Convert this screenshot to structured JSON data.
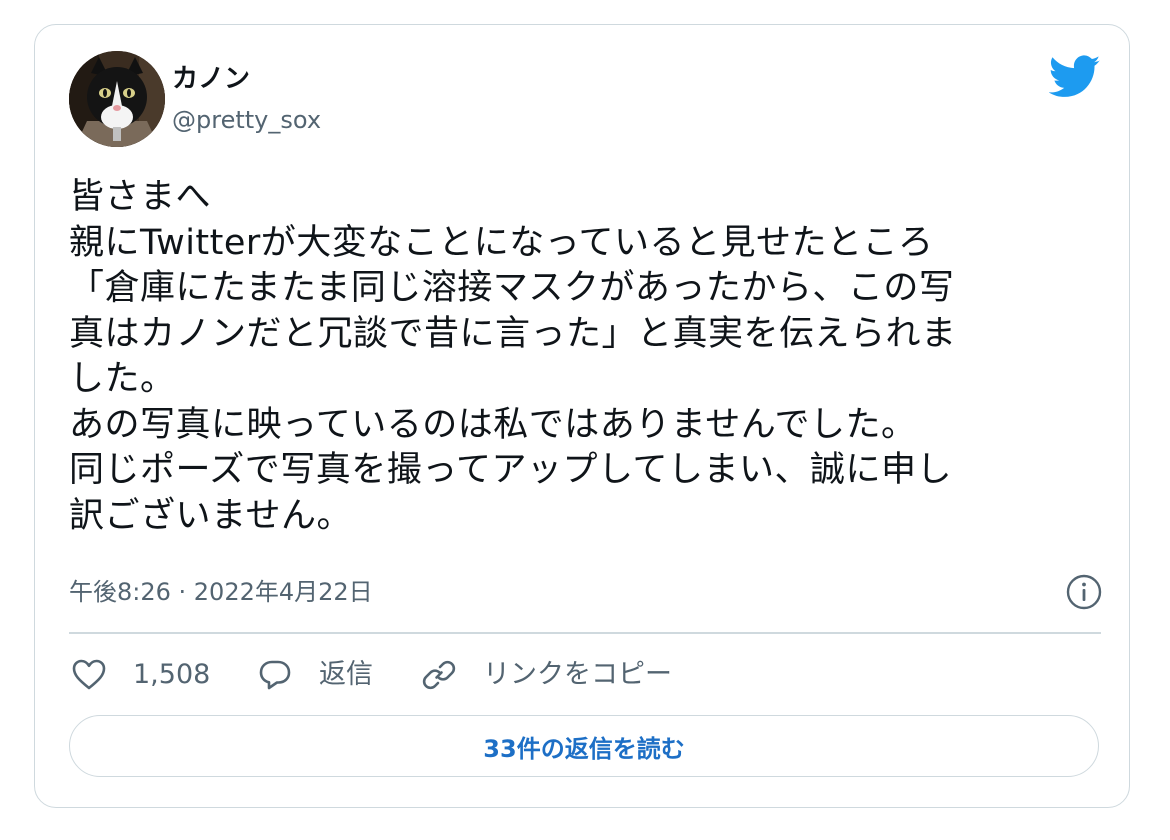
{
  "user": {
    "name": "カノン",
    "handle": "@pretty_sox",
    "avatar_icon": "cat-avatar"
  },
  "brand": {
    "icon": "twitter-bird-icon",
    "color": "#1d9bf0"
  },
  "tweet": {
    "lines": [
      "皆さまへ",
      "親にTwitterが大変なことになっていると見せたところ",
      "「倉庫にたまたま同じ溶接マスクがあったから、この写",
      "真はカノンだと冗談で昔に言った」と真実を伝えられま",
      "した。",
      "あの写真に映っているのは私ではありませんでした。",
      "同じポーズで写真を撮ってアップしてしまい、誠に申し",
      "訳ございません。"
    ],
    "timestamp": "午後8:26 · 2022年4月22日"
  },
  "actions": {
    "like_count": "1,508",
    "reply_label": "返信",
    "copy_link_label": "リンクをコピー"
  },
  "replies_button_label": "33件の返信を読む",
  "colors": {
    "text": "#0f1419",
    "secondary": "#536471",
    "border": "#cfd9de",
    "link": "#1d6fc6"
  }
}
